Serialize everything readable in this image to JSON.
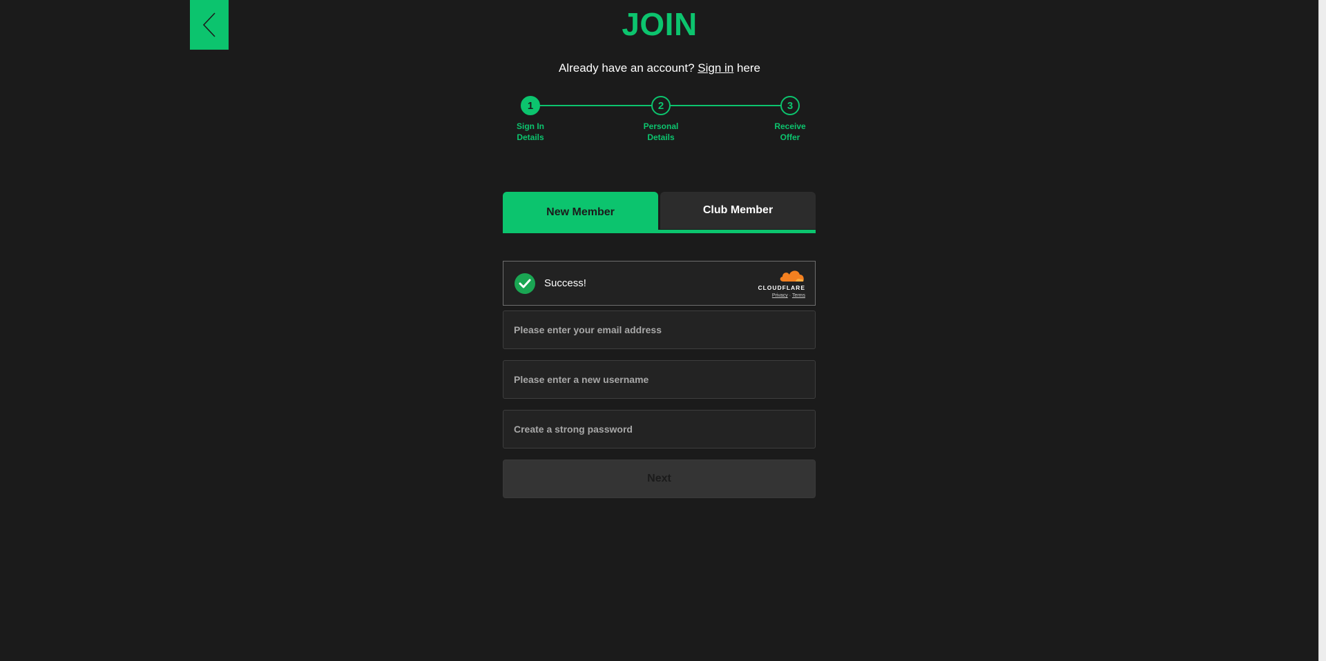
{
  "header": {
    "title": "JOIN",
    "signin_prefix": "Already have an account? ",
    "signin_link": "Sign in",
    "signin_suffix": " here"
  },
  "stepper": {
    "steps": [
      {
        "number": "1",
        "label_line1": "Sign In",
        "label_line2": "Details",
        "state": "active"
      },
      {
        "number": "2",
        "label_line1": "Personal",
        "label_line2": "Details",
        "state": "pending"
      },
      {
        "number": "3",
        "label_line1": "Receive",
        "label_line2": "Offer",
        "state": "pending"
      }
    ]
  },
  "tabs": {
    "new_member": "New Member",
    "club_member": "Club Member",
    "selected": "New Member"
  },
  "captcha": {
    "status": "Success!",
    "brand": "CLOUDFLARE",
    "privacy": "Privacy",
    "separator": "·",
    "terms": "Terms"
  },
  "form": {
    "email_placeholder": "Please enter your email address",
    "username_placeholder": "Please enter a new username",
    "password_placeholder": "Create a strong password",
    "email_value": "",
    "username_value": "",
    "password_value": "",
    "next_label": "Next"
  },
  "icons": {
    "back": "chevron-left-icon",
    "captcha_check": "checkmark-icon",
    "cloudflare": "cloudflare-logo"
  },
  "colors": {
    "accent": "#0cc46e",
    "background": "#1b1b1b",
    "success": "#1aa653",
    "cloudflare_orange": "#f38020"
  }
}
